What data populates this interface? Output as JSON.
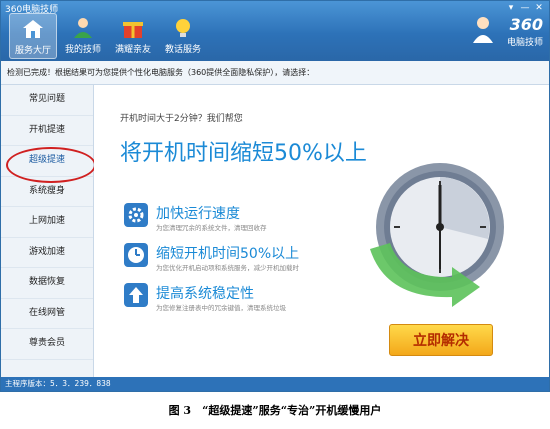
{
  "window": {
    "title": "360电脑技师"
  },
  "nav": [
    {
      "label": "服务大厅",
      "icon": "home-icon"
    },
    {
      "label": "我的技师",
      "icon": "technician-icon"
    },
    {
      "label": "满耀亲友",
      "icon": "gift-icon"
    },
    {
      "label": "教话服务",
      "icon": "lightbulb-icon"
    }
  ],
  "brand": {
    "logo": "360",
    "name": "电脑技师"
  },
  "notice": "检测已完成！根据结果可为您提供个性化电脑服务（360提供全面隐私保护），请选择：",
  "sidebar": [
    "常见问题",
    "开机提速",
    "超级提速",
    "系统瘦身",
    "上网加速",
    "游戏加速",
    "数据恢复",
    "在线网管",
    "尊贵会员"
  ],
  "main": {
    "subtitle": "开机时间大于2分钟？我们帮您",
    "headline": "将开机时间缩短50%以上",
    "features": [
      {
        "title": "加快运行速度",
        "desc": "为您清理冗余的系统文件，清理回收存",
        "icon": "gear-icon"
      },
      {
        "title": "缩短开机时间50%以上",
        "desc": "为您优化开机启动项和系统服务，减少开机加载时",
        "icon": "clock-icon"
      },
      {
        "title": "提高系统稳定性",
        "desc": "为您修复注册表中的冗余键值，清理系统垃圾",
        "icon": "upload-arrow-icon"
      }
    ],
    "button": "立即解决"
  },
  "status": {
    "version": "主程序版本：5．3．239．838"
  },
  "caption": "图 3　“超级提速”服务“专治”开机缓慢用户",
  "colors": {
    "titlebar": "#2d72b8",
    "accent": "#1b8ad6",
    "highlight": "#d02020",
    "button": "#f3a81a"
  }
}
